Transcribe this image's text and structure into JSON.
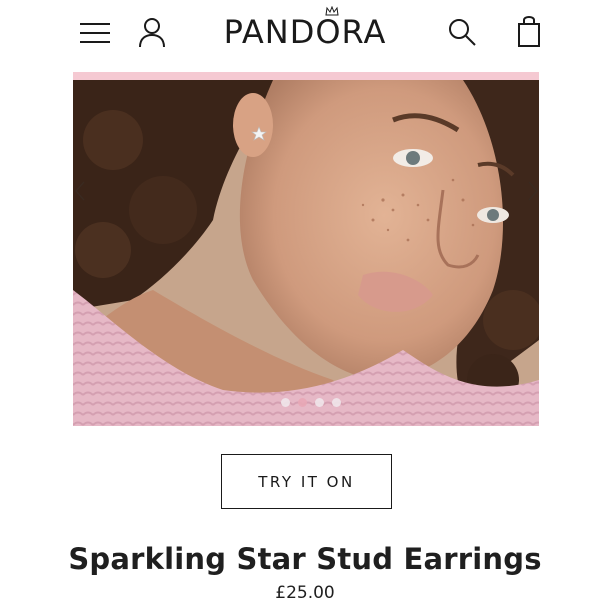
{
  "header": {
    "brand": "PANDORA",
    "icons": [
      "hamburger-menu-icon",
      "account-icon",
      "search-icon",
      "shopping-bag-icon"
    ]
  },
  "carousel": {
    "slide_count": 4,
    "active_slide": 2,
    "arrows": [
      "chevron-left-icon",
      "chevron-right-icon"
    ]
  },
  "product": {
    "try_on_label": "TRY IT ON",
    "name": "Sparkling Star Stud Earrings",
    "price": "£25.00"
  },
  "colors": {
    "accent_pink": "#f5c9d2",
    "active_dot": "#e8a7b6",
    "text": "#1a1a1a"
  }
}
